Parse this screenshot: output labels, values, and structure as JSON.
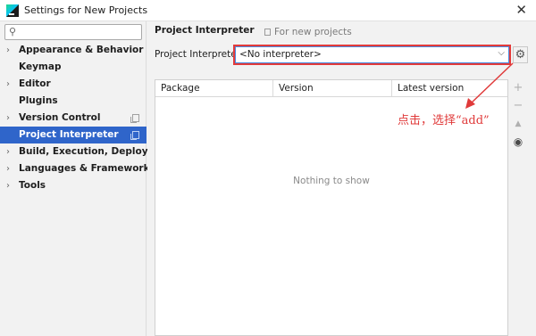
{
  "window": {
    "title": "Settings for New Projects",
    "close_glyph": "✕"
  },
  "sidebar": {
    "search": {
      "value": "",
      "placeholder": ""
    },
    "items": [
      {
        "label": "Appearance & Behavior",
        "expandable": true,
        "has_copy_icon": false,
        "selected": false
      },
      {
        "label": "Keymap",
        "expandable": false,
        "has_copy_icon": false,
        "selected": false
      },
      {
        "label": "Editor",
        "expandable": true,
        "has_copy_icon": false,
        "selected": false
      },
      {
        "label": "Plugins",
        "expandable": false,
        "has_copy_icon": false,
        "selected": false
      },
      {
        "label": "Version Control",
        "expandable": true,
        "has_copy_icon": true,
        "selected": false
      },
      {
        "label": "Project Interpreter",
        "expandable": false,
        "has_copy_icon": true,
        "selected": true
      },
      {
        "label": "Build, Execution, Deployment",
        "expandable": true,
        "has_copy_icon": false,
        "selected": false
      },
      {
        "label": "Languages & Frameworks",
        "expandable": true,
        "has_copy_icon": false,
        "selected": false
      },
      {
        "label": "Tools",
        "expandable": true,
        "has_copy_icon": false,
        "selected": false
      }
    ]
  },
  "main": {
    "page_title": "Project Interpreter",
    "scope_note": "For new projects",
    "interpreter_label": "Project Interpreter:",
    "interpreter_value": "<No interpreter>",
    "table": {
      "columns": [
        "Package",
        "Version",
        "Latest version"
      ],
      "empty_message": "Nothing to show"
    },
    "tools": {
      "add": "+",
      "remove": "−",
      "upgrade": "▲",
      "show": "◉"
    }
  },
  "annotation": {
    "text": "点击，选择“add”",
    "color": "#e03a3a"
  },
  "colors": {
    "selection": "#2f65ca",
    "highlight": "#e23b3b",
    "focus": "#4a8be0"
  },
  "icons": {
    "search": "search-icon",
    "expand": "chevron-right-icon",
    "copy": "copy-icon",
    "dropdown": "chevron-down-icon",
    "settings": "gear-icon",
    "show": "eye-icon"
  }
}
